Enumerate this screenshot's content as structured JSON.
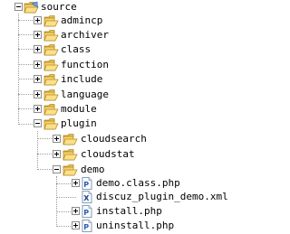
{
  "tree": {
    "root": {
      "label": "source"
    },
    "level1": [
      {
        "label": "admincp"
      },
      {
        "label": "archiver"
      },
      {
        "label": "class"
      },
      {
        "label": "function"
      },
      {
        "label": "include"
      },
      {
        "label": "language"
      },
      {
        "label": "module"
      },
      {
        "label": "plugin"
      }
    ],
    "plugin_children": [
      {
        "label": "cloudsearch"
      },
      {
        "label": "cloudstat"
      },
      {
        "label": "demo"
      }
    ],
    "demo_children": [
      {
        "label": "demo.class.php",
        "file_type": "php"
      },
      {
        "label": "discuz_plugin_demo.xml",
        "file_type": "xml"
      },
      {
        "label": "install.php",
        "file_type": "php"
      },
      {
        "label": "uninstall.php",
        "file_type": "php"
      }
    ]
  },
  "colors": {
    "folder_fill": "#f5d36b",
    "folder_edge": "#b58a22",
    "tree_line": "#9c9c9c",
    "file_php_mark": "#2a5db0",
    "file_xml_mark": "#1a3f8f"
  },
  "icons": {
    "folder": "open-folder-icon",
    "php_file": "php-file-icon",
    "xml_file": "xml-file-icon"
  }
}
